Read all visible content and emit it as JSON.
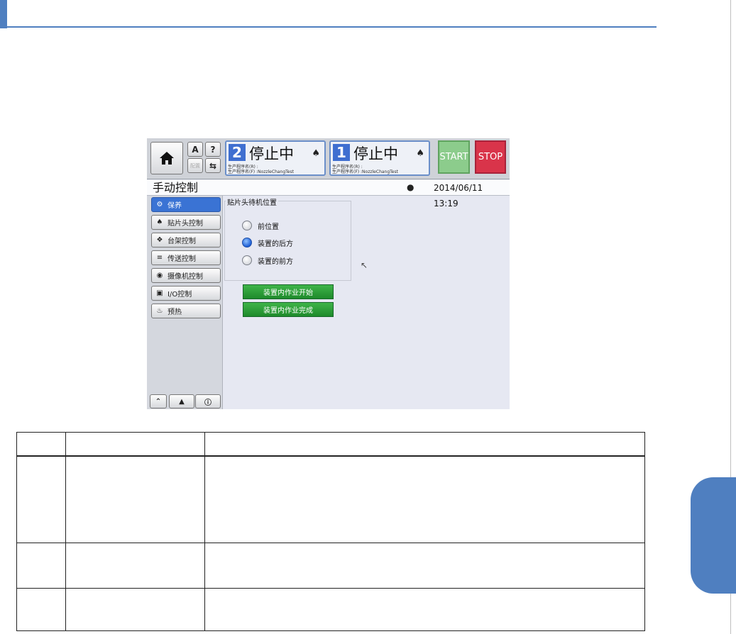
{
  "top_bar": {
    "mini_buttons": [
      "A",
      "?",
      "配置",
      "⇆"
    ],
    "lines": [
      {
        "number": "2",
        "status": "停止中",
        "info": [
          "生产程序名(R) :",
          "生产程序名(F) :NozzleChangTest"
        ]
      },
      {
        "number": "1",
        "status": "停止中",
        "info": [
          "生产程序名(R) :",
          "生产程序名(F) :NozzleChangTest"
        ]
      }
    ],
    "start_label": "START",
    "stop_label": "STOP"
  },
  "header": {
    "title": "手动控制",
    "datetime": "2014/06/11 13:19"
  },
  "sidebar": {
    "items": [
      {
        "label": "保养",
        "icon": "maintenance-icon",
        "active": true
      },
      {
        "label": "贴片头控制",
        "icon": "head-icon"
      },
      {
        "label": "台架控制",
        "icon": "gantry-icon"
      },
      {
        "label": "传送控制",
        "icon": "conveyor-icon"
      },
      {
        "label": "摄像机控制",
        "icon": "camera-icon"
      },
      {
        "label": "I/O控制",
        "icon": "io-icon"
      },
      {
        "label": "预热",
        "icon": "preheat-icon"
      }
    ],
    "bottom_buttons": [
      "chevron-up-icon",
      "warning-icon",
      "info-icon"
    ]
  },
  "main": {
    "group_label": "贴片头待机位置",
    "options": [
      {
        "label": "前位置",
        "selected": false
      },
      {
        "label": "装置的后方",
        "selected": true
      },
      {
        "label": "装置的前方",
        "selected": false
      }
    ],
    "buttons": [
      "装置内作业开始",
      "装置内作业完成"
    ]
  },
  "colors": {
    "accent": "#4f7fc0",
    "start": "#8ccc8c",
    "stop": "#d9344a",
    "action_green": "#2a9e37"
  }
}
